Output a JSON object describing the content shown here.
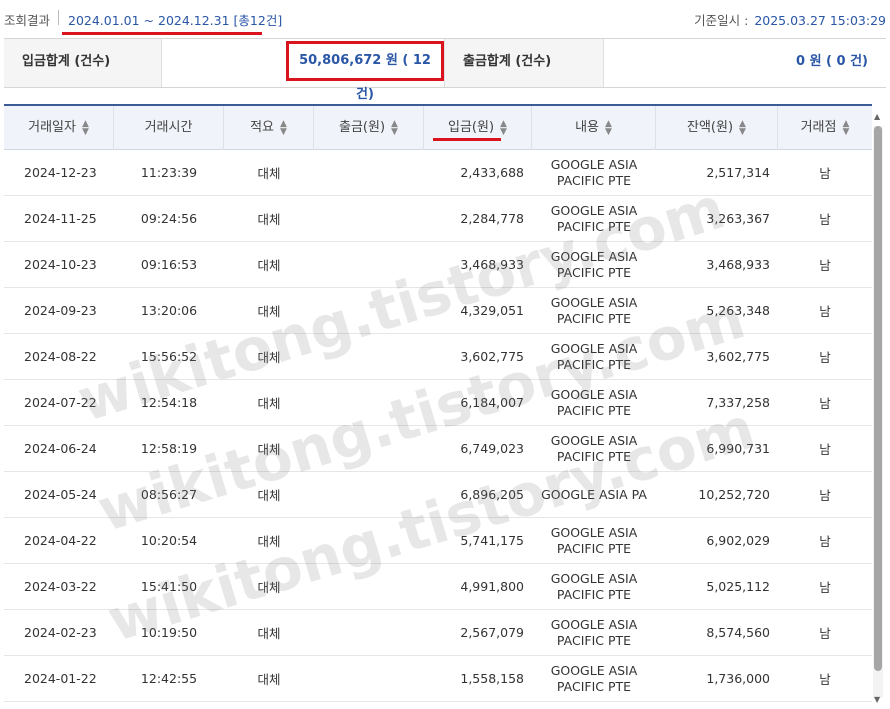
{
  "query": {
    "label": "조회결과",
    "period": "2024.01.01 ~ 2024.12.31 [총12건]",
    "base_label": "기준일시 :",
    "base_value": "2025.03.27 15:03:29"
  },
  "summary": {
    "deposit_label": "입금합계 (건수)",
    "deposit_value": "50,806,672 원 ( 12 건)",
    "withdraw_label": "출금합계 (건수)",
    "withdraw_value": "0 원 ( 0 건)"
  },
  "table": {
    "headers": [
      "거래일자",
      "거래시간",
      "적요",
      "출금(원)",
      "입금(원)",
      "내용",
      "잔액(원)",
      "거래점"
    ],
    "rows": [
      {
        "date": "2024-12-23",
        "time": "11:23:39",
        "memo": "대체",
        "withdraw": "",
        "deposit": "2,433,688",
        "desc1": "GOOGLE ASIA",
        "desc2": "PACIFIC PTE",
        "balance": "2,517,314",
        "branch": "남"
      },
      {
        "date": "2024-11-25",
        "time": "09:24:56",
        "memo": "대체",
        "withdraw": "",
        "deposit": "2,284,778",
        "desc1": "GOOGLE ASIA",
        "desc2": "PACIFIC PTE",
        "balance": "3,263,367",
        "branch": "남"
      },
      {
        "date": "2024-10-23",
        "time": "09:16:53",
        "memo": "대체",
        "withdraw": "",
        "deposit": "3,468,933",
        "desc1": "GOOGLE ASIA",
        "desc2": "PACIFIC PTE",
        "balance": "3,468,933",
        "branch": "남"
      },
      {
        "date": "2024-09-23",
        "time": "13:20:06",
        "memo": "대체",
        "withdraw": "",
        "deposit": "4,329,051",
        "desc1": "GOOGLE ASIA",
        "desc2": "PACIFIC PTE",
        "balance": "5,263,348",
        "branch": "남"
      },
      {
        "date": "2024-08-22",
        "time": "15:56:52",
        "memo": "대체",
        "withdraw": "",
        "deposit": "3,602,775",
        "desc1": "GOOGLE ASIA",
        "desc2": "PACIFIC PTE",
        "balance": "3,602,775",
        "branch": "남"
      },
      {
        "date": "2024-07-22",
        "time": "12:54:18",
        "memo": "대체",
        "withdraw": "",
        "deposit": "6,184,007",
        "desc1": "GOOGLE ASIA",
        "desc2": "PACIFIC PTE",
        "balance": "7,337,258",
        "branch": "남"
      },
      {
        "date": "2024-06-24",
        "time": "12:58:19",
        "memo": "대체",
        "withdraw": "",
        "deposit": "6,749,023",
        "desc1": "GOOGLE ASIA",
        "desc2": "PACIFIC PTE",
        "balance": "6,990,731",
        "branch": "남"
      },
      {
        "date": "2024-05-24",
        "time": "08:56:27",
        "memo": "대체",
        "withdraw": "",
        "deposit": "6,896,205",
        "desc1": "GOOGLE ASIA PA",
        "desc2": "",
        "balance": "10,252,720",
        "branch": "남"
      },
      {
        "date": "2024-04-22",
        "time": "10:20:54",
        "memo": "대체",
        "withdraw": "",
        "deposit": "5,741,175",
        "desc1": "GOOGLE ASIA",
        "desc2": "PACIFIC PTE",
        "balance": "6,902,029",
        "branch": "남"
      },
      {
        "date": "2024-03-22",
        "time": "15:41:50",
        "memo": "대체",
        "withdraw": "",
        "deposit": "4,991,800",
        "desc1": "GOOGLE ASIA",
        "desc2": "PACIFIC PTE",
        "balance": "5,025,112",
        "branch": "남"
      },
      {
        "date": "2024-02-23",
        "time": "10:19:50",
        "memo": "대체",
        "withdraw": "",
        "deposit": "2,567,079",
        "desc1": "GOOGLE ASIA",
        "desc2": "PACIFIC PTE",
        "balance": "8,574,560",
        "branch": "남"
      },
      {
        "date": "2024-01-22",
        "time": "12:42:55",
        "memo": "대체",
        "withdraw": "",
        "deposit": "1,558,158",
        "desc1": "GOOGLE ASIA",
        "desc2": "PACIFIC PTE",
        "balance": "1,736,000",
        "branch": "남"
      }
    ]
  },
  "watermark": "wikitong.tistory.com",
  "colors": {
    "accent": "#2a56a6",
    "highlight": "#d9141e",
    "header_border": "#3b5a96"
  }
}
